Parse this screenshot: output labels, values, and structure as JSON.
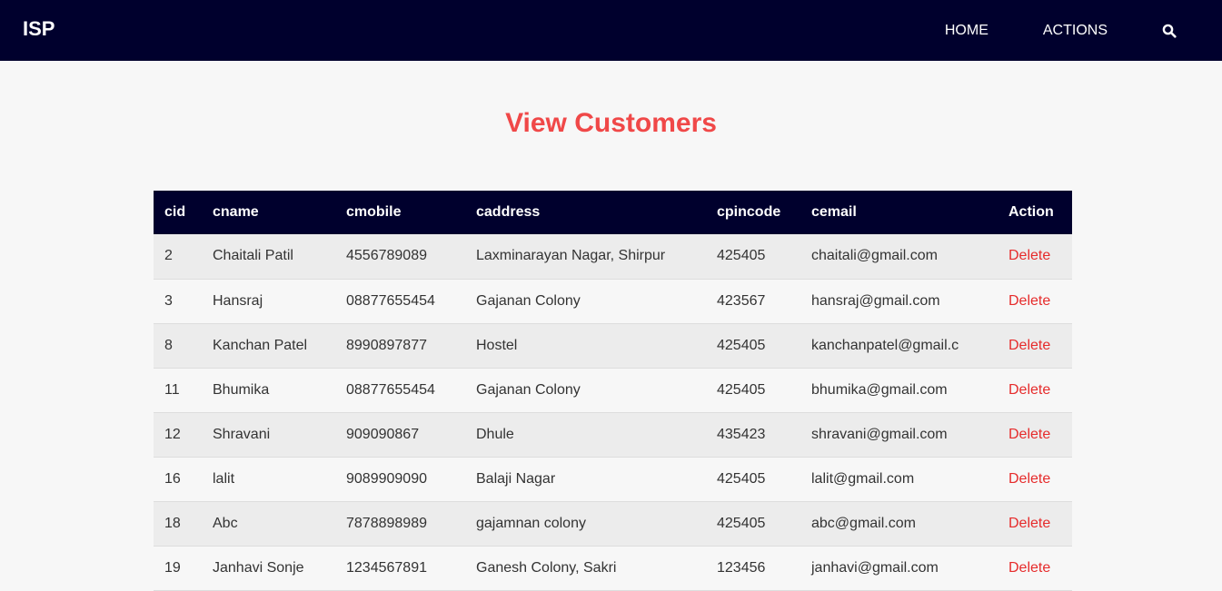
{
  "navbar": {
    "brand": "ISP",
    "links": [
      "HOME",
      "ACTIONS"
    ],
    "search_icon": "search-icon"
  },
  "page": {
    "title": "View Customers"
  },
  "table": {
    "headers": [
      "cid",
      "cname",
      "cmobile",
      "caddress",
      "cpincode",
      "cemail",
      "Action"
    ],
    "rows": [
      {
        "cid": "2",
        "cname": "Chaitali Patil",
        "cmobile": "4556789089",
        "caddress": "Laxminarayan Nagar, Shirpur",
        "cpincode": "425405",
        "cemail": "chaitali@gmail.com",
        "action": "Delete"
      },
      {
        "cid": "3",
        "cname": "Hansraj",
        "cmobile": "08877655454",
        "caddress": "Gajanan Colony",
        "cpincode": "423567",
        "cemail": "hansraj@gmail.com",
        "action": "Delete"
      },
      {
        "cid": "8",
        "cname": "Kanchan Patel",
        "cmobile": "8990897877",
        "caddress": "Hostel",
        "cpincode": "425405",
        "cemail": "kanchanpatel@gmail.c",
        "action": "Delete"
      },
      {
        "cid": "11",
        "cname": "Bhumika",
        "cmobile": "08877655454",
        "caddress": "Gajanan Colony",
        "cpincode": "425405",
        "cemail": "bhumika@gmail.com",
        "action": "Delete"
      },
      {
        "cid": "12",
        "cname": "Shravani",
        "cmobile": "909090867",
        "caddress": "Dhule",
        "cpincode": "435423",
        "cemail": "shravani@gmail.com",
        "action": "Delete"
      },
      {
        "cid": "16",
        "cname": "lalit",
        "cmobile": "9089909090",
        "caddress": "Balaji Nagar",
        "cpincode": "425405",
        "cemail": "lalit@gmail.com",
        "action": "Delete"
      },
      {
        "cid": "18",
        "cname": "Abc",
        "cmobile": "7878898989",
        "caddress": "gajamnan colony",
        "cpincode": "425405",
        "cemail": "abc@gmail.com",
        "action": "Delete"
      },
      {
        "cid": "19",
        "cname": "Janhavi Sonje",
        "cmobile": "1234567891",
        "caddress": "Ganesh Colony, Sakri",
        "cpincode": "123456",
        "cemail": "janhavi@gmail.com",
        "action": "Delete"
      }
    ]
  },
  "colors": {
    "navbar_bg": "#00002d",
    "title": "#f04848",
    "delete_link": "#e62b2b"
  }
}
